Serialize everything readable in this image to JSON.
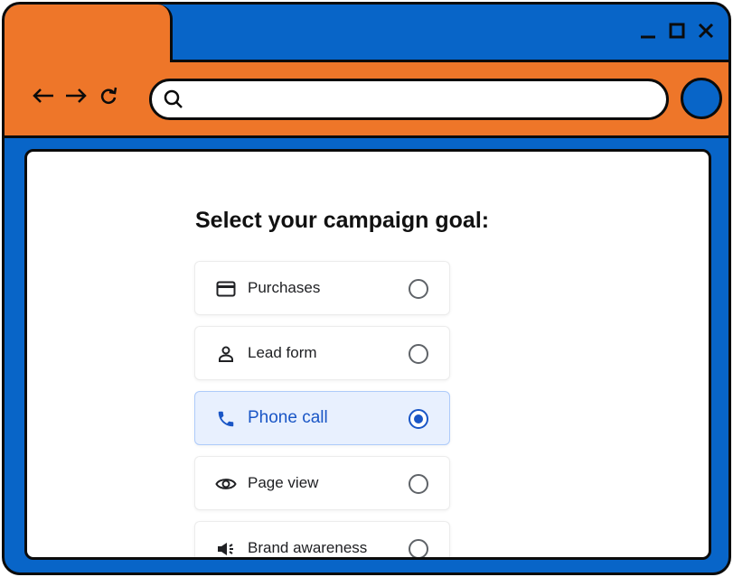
{
  "browser": {
    "window_controls": {
      "minimize_icon": "minimize-icon",
      "maximize_icon": "maximize-icon",
      "close_icon": "close-icon"
    },
    "nav": {
      "back_icon": "arrow-left-icon",
      "forward_icon": "arrow-right-icon",
      "reload_icon": "reload-icon"
    },
    "address_bar": {
      "value": "",
      "placeholder": ""
    },
    "colors": {
      "frame": "#0865C8",
      "toolbar": "#EE7629"
    }
  },
  "page": {
    "heading": "Select your campaign goal:",
    "options": [
      {
        "label": "Purchases",
        "icon": "credit-card-icon",
        "selected": false
      },
      {
        "label": "Lead form",
        "icon": "person-icon",
        "selected": false
      },
      {
        "label": "Phone call",
        "icon": "phone-icon",
        "selected": true
      },
      {
        "label": "Page view",
        "icon": "eye-icon",
        "selected": false
      },
      {
        "label": "Brand awareness",
        "icon": "megaphone-icon",
        "selected": false
      }
    ],
    "accent_color": "#1a56c6"
  }
}
